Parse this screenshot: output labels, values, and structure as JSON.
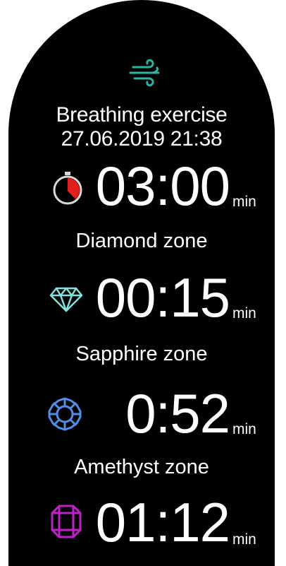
{
  "header": {
    "icon": "wind-icon",
    "title": "Breathing exercise",
    "datetime": "27.06.2019 21:38"
  },
  "total": {
    "icon": "stopwatch-icon",
    "value": "03:00",
    "unit": "min"
  },
  "zones": [
    {
      "label": "Diamond zone",
      "icon": "diamond-icon",
      "value": "00:15",
      "unit": "min",
      "color": "#7fe3e0"
    },
    {
      "label": "Sapphire zone",
      "icon": "sapphire-icon",
      "value": "0:52",
      "unit": "min",
      "color": "#4f8fe8"
    },
    {
      "label": "Amethyst zone",
      "icon": "amethyst-icon",
      "value": "01:12",
      "unit": "min",
      "color": "#c020c8"
    }
  ],
  "colors": {
    "background": "#000000",
    "accent_teal": "#2bb3a8",
    "stopwatch_red": "#e0201c"
  }
}
